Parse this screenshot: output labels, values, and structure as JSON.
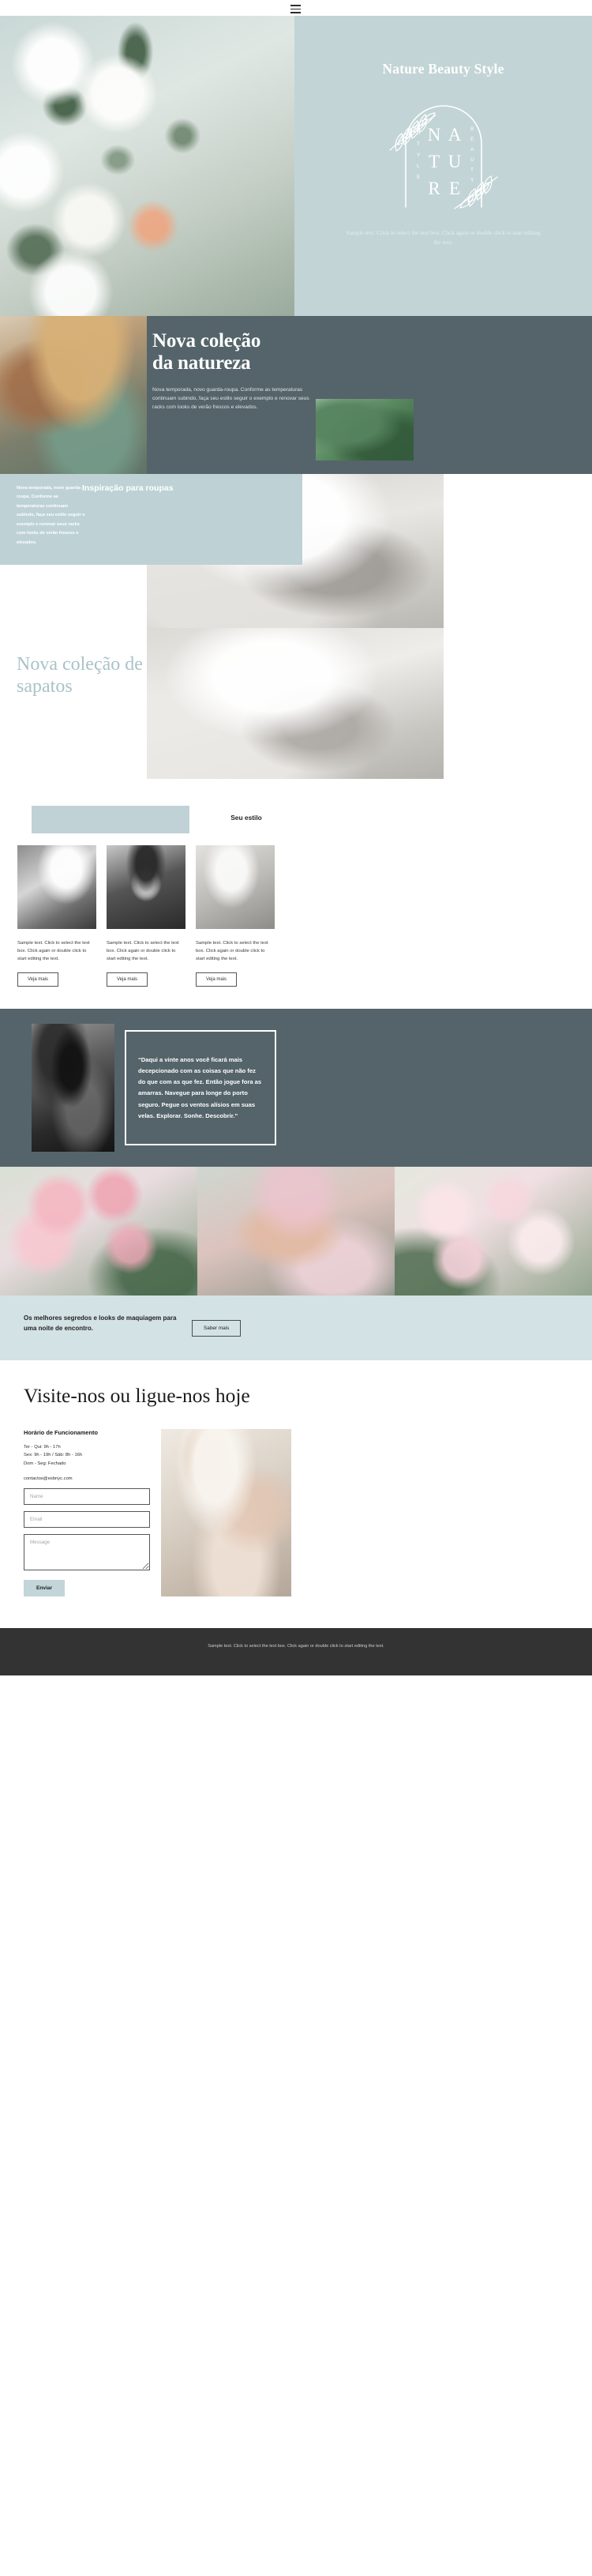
{
  "hero": {
    "menu_icon": "hamburger-menu-icon",
    "title": "Nature Beauty Style",
    "emblem": {
      "center_letters": [
        "N",
        "A",
        "T",
        "U",
        "R",
        "E"
      ],
      "left_letters": "STYLE",
      "right_letters": "BEAUTY",
      "left_word": "STYLE",
      "right_word": "BEAUTY"
    },
    "subtitle": "Sample text. Click to select the text box. Click again or double click to start editing the text."
  },
  "nature_collection": {
    "title_line1": "Nova coleção",
    "title_line2": "da natureza",
    "body": "Nova temporada, novo guarda-roupa. Conforme as temperaturas continuam subindo, faça seu estilo seguir o exemplo e renovar seus racks com looks de verão frescos e elevados."
  },
  "clothing_inspiration": {
    "copy": "Nova temporada, novo guarda-roupa. Conforme as temperaturas continuam subindo, faça seu estilo seguir o exemplo e renovar seus racks com looks de verão frescos e elevados.",
    "heading": "Inspiração para roupas"
  },
  "shoes_collection": {
    "title": "Nova coleção de sapatos"
  },
  "style_section": {
    "heading": "Seu estilo",
    "cards": [
      {
        "text": "Sample text. Click to select the text box. Click again or double click to start editing the text.",
        "button": "Veja mais"
      },
      {
        "text": "Sample text. Click to select the text box. Click again or double click to start editing the text.",
        "button": "Veja mais"
      },
      {
        "text": "Sample text. Click to select the text box. Click again or double click to start editing the text.",
        "button": "Veja mais"
      }
    ]
  },
  "quote_section": {
    "quote": "“Daqui a vinte anos você ficará mais decepcionado com as coisas que não fez do que com as que fez. Então jogue fora as amarras. Navegue para longe do porto seguro. Pegue os ventos alísios em suas velas. Explorar. Sonhe. Descobrir.”"
  },
  "secrets_band": {
    "text": "Os melhores segredos e looks de maquiagem para uma noite de encontro.",
    "button": "Saber mais"
  },
  "contact": {
    "title_line1": "Visite-nos ou ligue-nos",
    "title_line2": "hoje",
    "hours_heading": "Horário de Funcionamento",
    "hours": [
      "Ter - Qui: 9h - 17h",
      "Sex: 9h - 19h / Sáb: 8h - 16h",
      "Dom - Seg: Fechado"
    ],
    "email": "contactos@esbnyc.com",
    "form": {
      "name_placeholder": "Name",
      "name_value": "",
      "email_placeholder": "Email",
      "email_value": "",
      "message_placeholder": "Message",
      "message_value": "",
      "submit": "Enviar"
    }
  },
  "footer": {
    "text": "Sample text. Click to select the text box. Click again or double click to start editing the text."
  },
  "colors": {
    "hero_panel": "#c2d4d6",
    "dark_slate": "#54646a",
    "band_light": "#bed2d5",
    "band_lighter": "#d3e2e4",
    "shoes_title": "#a9c3c8",
    "footer_bg": "#333333",
    "submit_bg": "#c2d5d8"
  }
}
